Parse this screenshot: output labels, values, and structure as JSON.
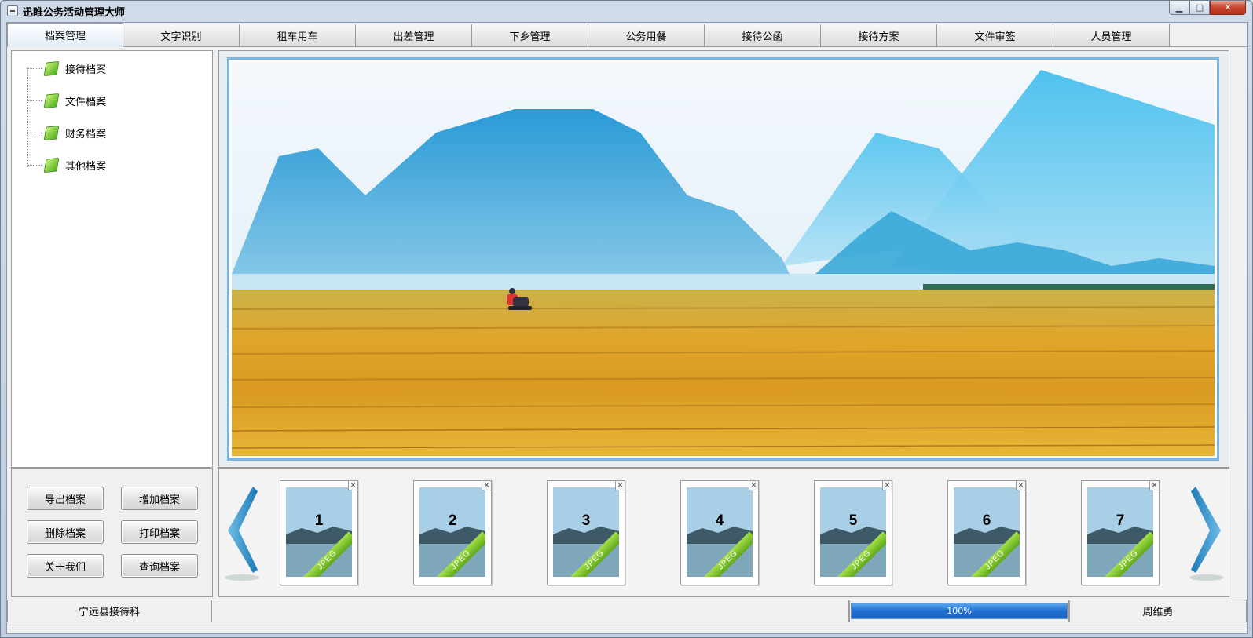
{
  "window": {
    "title": "迅睢公务活动管理大师",
    "min_label": "▁",
    "max_label": "□",
    "close_label": "✕"
  },
  "tabs": [
    {
      "label": "档案管理",
      "active": true
    },
    {
      "label": "文字识别"
    },
    {
      "label": "租车用车"
    },
    {
      "label": "出差管理"
    },
    {
      "label": "下乡管理"
    },
    {
      "label": "公务用餐"
    },
    {
      "label": "接待公函"
    },
    {
      "label": "接待方案"
    },
    {
      "label": "文件审签"
    },
    {
      "label": "人员管理"
    }
  ],
  "tree": {
    "items": [
      {
        "label": "接待档案",
        "icon": "book-icon"
      },
      {
        "label": "文件档案",
        "icon": "book-icon"
      },
      {
        "label": "财务档案",
        "icon": "book-icon"
      },
      {
        "label": "其他档案",
        "icon": "book-icon"
      }
    ]
  },
  "buttons": {
    "export": "导出档案",
    "add": "增加档案",
    "delete": "删除档案",
    "print": "打印档案",
    "about": "关于我们",
    "query": "查询档案"
  },
  "thumbnails": [
    {
      "number": "1",
      "badge": "JPEG"
    },
    {
      "number": "2",
      "badge": "JPEG"
    },
    {
      "number": "3",
      "badge": "JPEG"
    },
    {
      "number": "4",
      "badge": "JPEG"
    },
    {
      "number": "5",
      "badge": "JPEG"
    },
    {
      "number": "6",
      "badge": "JPEG"
    },
    {
      "number": "7",
      "badge": "JPEG"
    }
  ],
  "status": {
    "org": "宁远县接待科",
    "progress_text": "100%",
    "progress": 1.0,
    "user": "周维勇"
  },
  "colors": {
    "accent": "#7ab4e4",
    "progress": "#1f6fd1",
    "badge": "#6dbb22"
  }
}
